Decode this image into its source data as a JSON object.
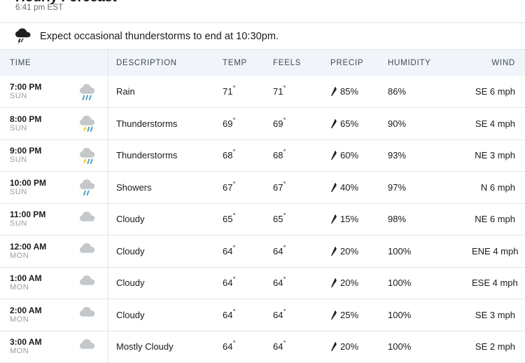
{
  "header": {
    "clipped_title": "Hourly Forecast",
    "observation_time": "6:41 pm EST"
  },
  "alert": {
    "icon": "thunderstorm-cloud-icon",
    "text": "Expect occasional thunderstorms to end at 10:30pm."
  },
  "table": {
    "columns": {
      "time": "TIME",
      "description": "DESCRIPTION",
      "temp": "TEMP",
      "feels": "FEELS",
      "precip": "PRECIP",
      "humidity": "HUMIDITY",
      "wind": "WIND"
    },
    "rows": [
      {
        "hour": "7:00 PM",
        "day": "SUN",
        "icon": "rain-icon",
        "description": "Rain",
        "temp": "71",
        "feels": "71",
        "precip": "85%",
        "humidity": "86%",
        "wind": "SE 6 mph"
      },
      {
        "hour": "8:00 PM",
        "day": "SUN",
        "icon": "thunderstorm-icon",
        "description": "Thunderstorms",
        "temp": "69",
        "feels": "69",
        "precip": "65%",
        "humidity": "90%",
        "wind": "SE 4 mph"
      },
      {
        "hour": "9:00 PM",
        "day": "SUN",
        "icon": "thunderstorm-icon",
        "description": "Thunderstorms",
        "temp": "68",
        "feels": "68",
        "precip": "60%",
        "humidity": "93%",
        "wind": "NE 3 mph"
      },
      {
        "hour": "10:00 PM",
        "day": "SUN",
        "icon": "showers-icon",
        "description": "Showers",
        "temp": "67",
        "feels": "67",
        "precip": "40%",
        "humidity": "97%",
        "wind": "N 6 mph"
      },
      {
        "hour": "11:00 PM",
        "day": "SUN",
        "icon": "cloudy-icon",
        "description": "Cloudy",
        "temp": "65",
        "feels": "65",
        "precip": "15%",
        "humidity": "98%",
        "wind": "NE 6 mph"
      },
      {
        "hour": "12:00 AM",
        "day": "MON",
        "icon": "cloudy-icon",
        "description": "Cloudy",
        "temp": "64",
        "feels": "64",
        "precip": "20%",
        "humidity": "100%",
        "wind": "ENE 4 mph"
      },
      {
        "hour": "1:00 AM",
        "day": "MON",
        "icon": "cloudy-icon",
        "description": "Cloudy",
        "temp": "64",
        "feels": "64",
        "precip": "20%",
        "humidity": "100%",
        "wind": "ESE 4 mph"
      },
      {
        "hour": "2:00 AM",
        "day": "MON",
        "icon": "cloudy-icon",
        "description": "Cloudy",
        "temp": "64",
        "feels": "64",
        "precip": "25%",
        "humidity": "100%",
        "wind": "SE 3 mph"
      },
      {
        "hour": "3:00 AM",
        "day": "MON",
        "icon": "mostly-cloudy-icon",
        "description": "Mostly Cloudy",
        "temp": "64",
        "feels": "64",
        "precip": "20%",
        "humidity": "100%",
        "wind": "SE 2 mph"
      }
    ]
  },
  "colors": {
    "header_bg": "#f1f5f9",
    "cloud_gray": "#c4c8cb",
    "rain_blue": "#4a9cc4",
    "lightning_yellow": "#f2d21e",
    "row_divider": "#e6e6e6"
  }
}
